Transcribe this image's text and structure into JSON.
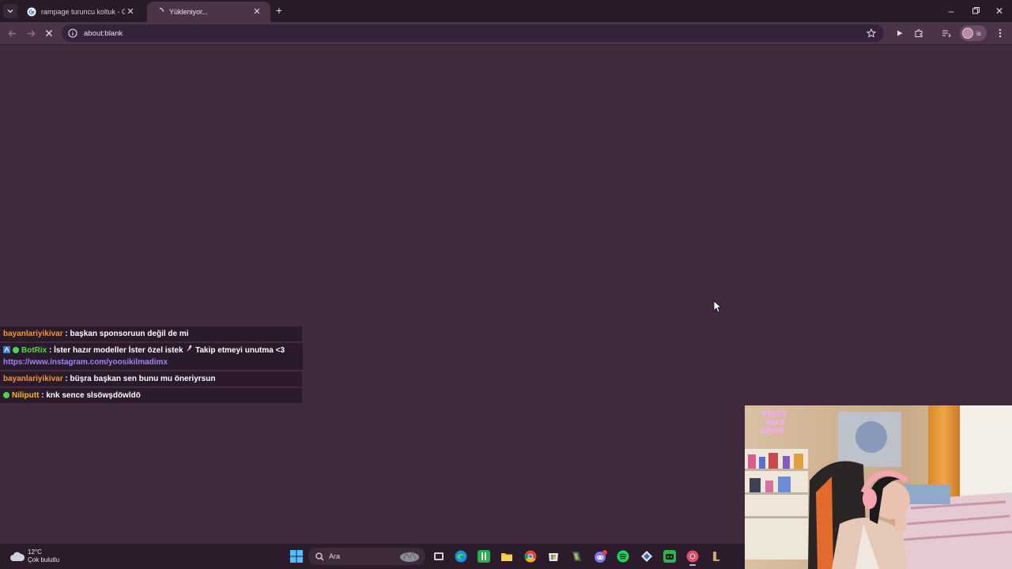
{
  "browser": {
    "tabs": [
      {
        "title": "rampage turuncu koltuk - Goog",
        "favicon": "google-icon",
        "active": false
      },
      {
        "title": "Yükleniyor...",
        "favicon": "loading-spinner-icon",
        "active": true
      }
    ],
    "address_bar": {
      "url": "about:blank"
    },
    "window_controls": [
      "minimize-icon",
      "restore-icon",
      "close-icon"
    ],
    "profile_initials": "is"
  },
  "chat": {
    "messages": [
      {
        "user": "bayanlariyikivar",
        "separator": ":",
        "text": "başkan sponsoruun değil de mi"
      },
      {
        "user": "BotRix",
        "separator": ":",
        "text": "İster hazır modeller İster özel istek",
        "text2": "Takip etmeyi unutma <3",
        "link": "https://www.instagram.com/yoosikilmadimx"
      },
      {
        "user": "bayanlariyikivar",
        "separator": ":",
        "text": "büşra başkan sen bunu mu öneriyrsun"
      },
      {
        "user": "Niliputt",
        "separator": ":",
        "text": "knk sence slsöwşdöwldö"
      }
    ],
    "colors": {
      "orange": "#f29a2e",
      "green": "#47e04a",
      "yellow": "#f7b924",
      "link": "#9b8af0"
    }
  },
  "webcam": {
    "neon_sign": [
      "SHOX",
      "WAS",
      "HERE"
    ]
  },
  "taskbar": {
    "weather": {
      "temp": "12°C",
      "condition": "Çok bulutlu"
    },
    "search_placeholder": "Ara",
    "apps": [
      "windows-start-icon",
      "task-view-icon",
      "edge-icon",
      "green-app-icon",
      "file-explorer-icon",
      "chrome-icon",
      "store-icon",
      "game-icon",
      "discord-icon",
      "spotify-icon",
      "network-app-icon",
      "green-bot-icon",
      "chrome-active-icon",
      "league-icon"
    ]
  },
  "page": {
    "background": "#402b3e"
  }
}
